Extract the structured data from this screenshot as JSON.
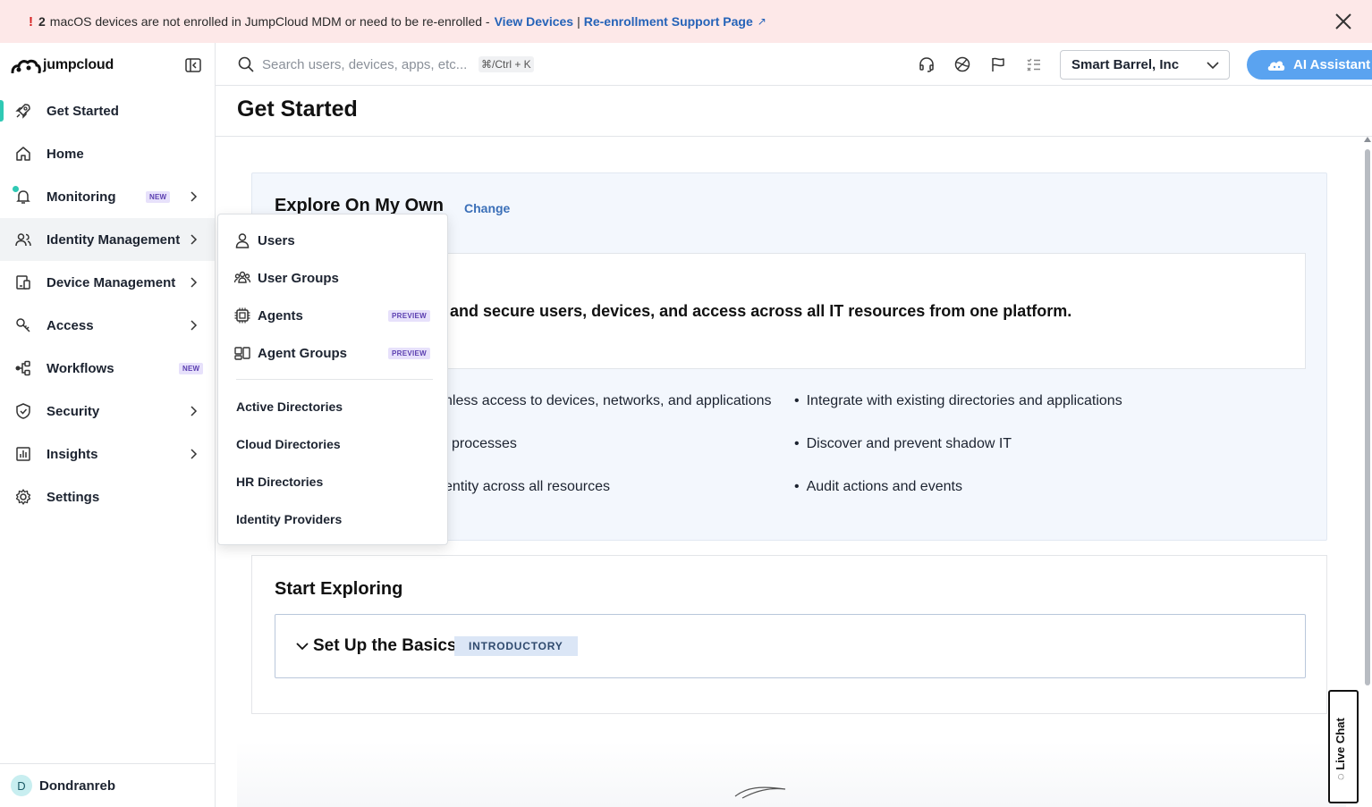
{
  "banner": {
    "count": "2",
    "message": "macOS devices are not enrolled in JumpCloud MDM or need to be re-enrolled -",
    "link_view": "View Devices",
    "separator": "|",
    "link_support": "Re-enrollment Support Page"
  },
  "sidebar": {
    "logo": "jumpcloud",
    "items": [
      {
        "label": "Get Started"
      },
      {
        "label": "Home"
      },
      {
        "label": "Monitoring",
        "badge": "NEW"
      },
      {
        "label": "Identity Management"
      },
      {
        "label": "Device Management"
      },
      {
        "label": "Access"
      },
      {
        "label": "Workflows",
        "badge": "NEW"
      },
      {
        "label": "Security"
      },
      {
        "label": "Insights"
      },
      {
        "label": "Settings"
      }
    ],
    "user": {
      "initial": "D",
      "name": "Dondranreb"
    }
  },
  "topbar": {
    "search_placeholder": "Search users, devices, apps, etc...",
    "shortcut": "⌘/Ctrl + K",
    "org": "Smart Barrel, Inc",
    "ai_label": "AI Assistant"
  },
  "main": {
    "title": "Get Started",
    "explore": {
      "title": "Explore On My Own",
      "change": "Change",
      "headline": "and secure users, devices, and access across all IT resources from one platform.",
      "left_bullets": [
        "nless access to devices, networks, and applications",
        "processes",
        "entity across all resources"
      ],
      "right_bullets": [
        "Integrate with existing directories and applications",
        "Discover and prevent shadow IT",
        "Audit actions and events"
      ]
    },
    "start": {
      "title": "Start Exploring",
      "accordion_title": "Set Up the Basics",
      "accordion_badge": "INTRODUCTORY"
    }
  },
  "dropdown": {
    "icon_items": [
      {
        "label": "Users"
      },
      {
        "label": "User Groups"
      },
      {
        "label": "Agents",
        "badge": "PREVIEW"
      },
      {
        "label": "Agent Groups",
        "badge": "PREVIEW"
      }
    ],
    "plain_items": [
      {
        "label": "Active Directories"
      },
      {
        "label": "Cloud Directories"
      },
      {
        "label": "HR Directories"
      },
      {
        "label": "Identity Providers"
      }
    ]
  },
  "live_chat": "Live Chat",
  "colors": {
    "accent": "#2fc9b4",
    "link": "#2563b8",
    "ai_button": "#5aa3f0",
    "banner_bg": "#fde8e8"
  }
}
